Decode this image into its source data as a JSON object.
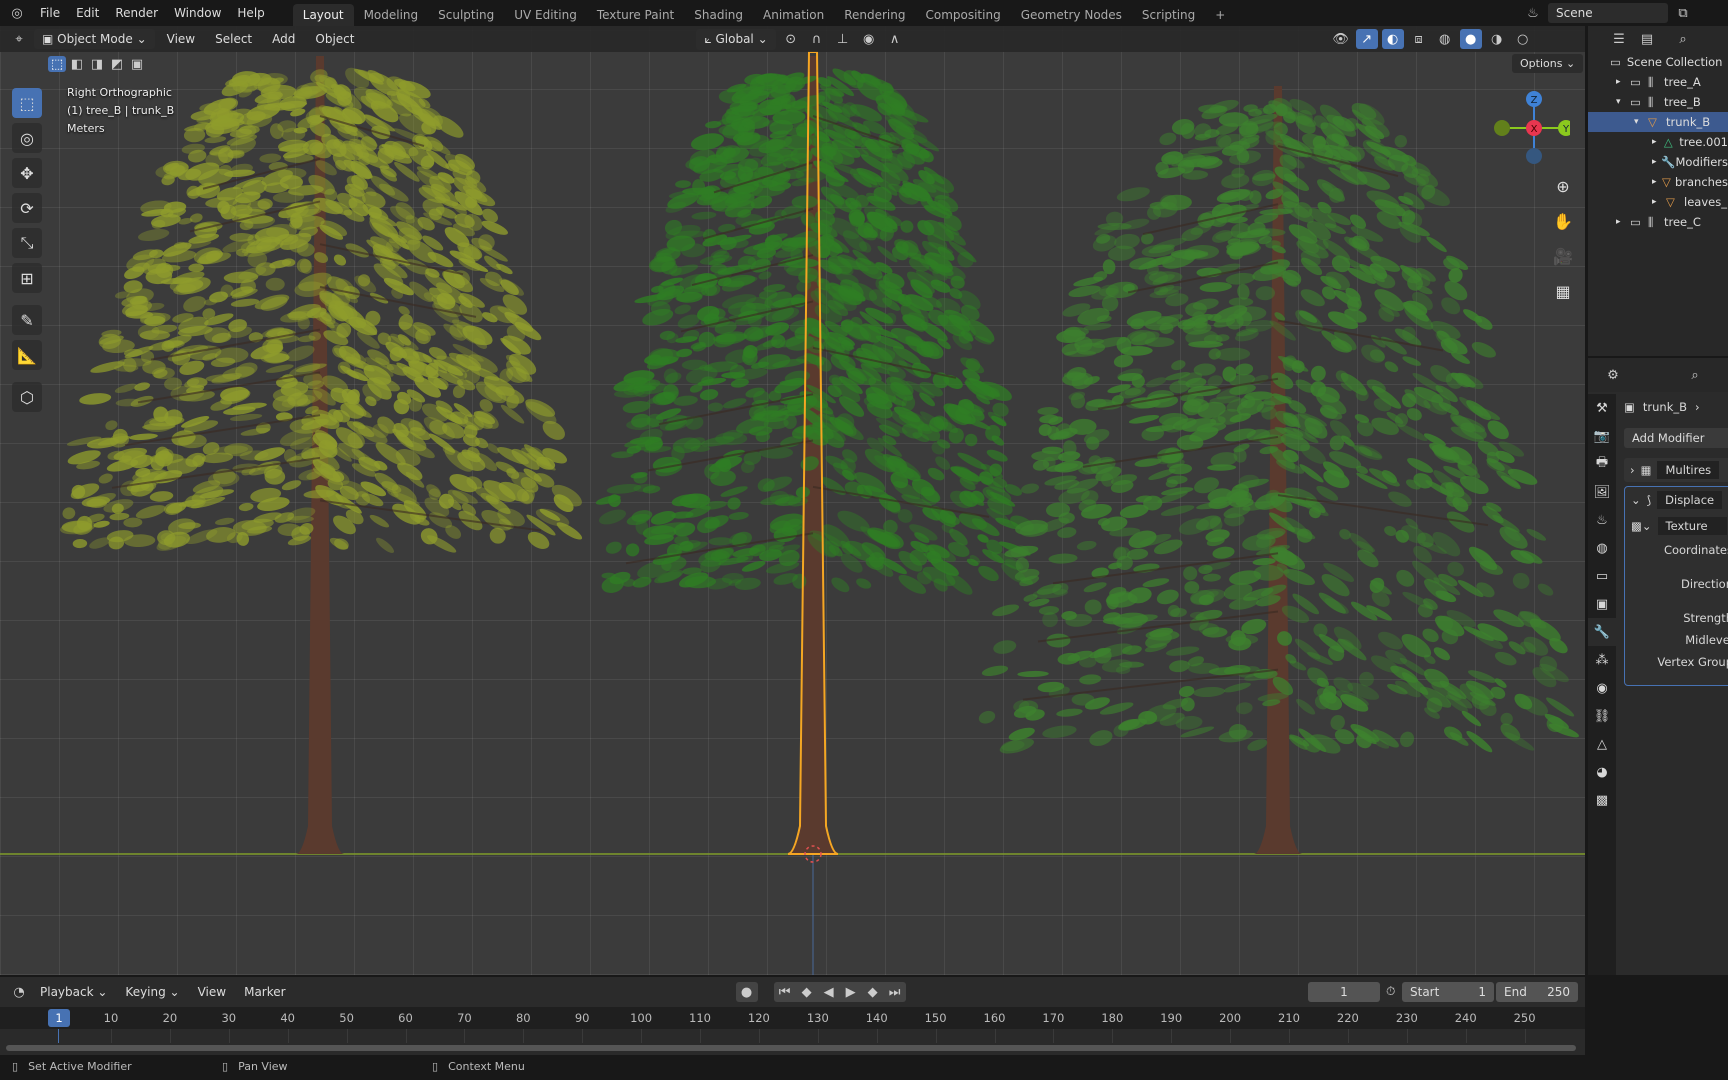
{
  "topbar": {
    "logo": "blender-logo",
    "menus": [
      "File",
      "Edit",
      "Render",
      "Window",
      "Help"
    ],
    "workspaces": [
      "Layout",
      "Modeling",
      "Sculpting",
      "UV Editing",
      "Texture Paint",
      "Shading",
      "Animation",
      "Rendering",
      "Compositing",
      "Geometry Nodes",
      "Scripting"
    ],
    "active_workspace": "Layout",
    "add_tab": "+",
    "scene": "Scene"
  },
  "viewport_header": {
    "mode": "Object Mode",
    "menus": [
      "View",
      "Select",
      "Add",
      "Object"
    ],
    "orientation": "Global",
    "options": "Options"
  },
  "overlay": {
    "view": "Right Orthographic",
    "object": "(1) tree_B | trunk_B",
    "units": "Meters"
  },
  "gizmo": {
    "z": "Z",
    "x": "X",
    "y": "Y",
    "colors": {
      "x": "#e8364f",
      "y": "#8bc91e",
      "z": "#3f82d6"
    }
  },
  "toolbar": [
    "select-box",
    "cursor",
    "move",
    "rotate",
    "scale",
    "transform",
    "annotate",
    "measure",
    "add-cube"
  ],
  "nav_icons": [
    "zoom",
    "pan-hand",
    "camera",
    "ortho-grid"
  ],
  "outliner": {
    "root": "Scene Collection",
    "items": [
      {
        "label": "tree_A",
        "depth": 0,
        "exp": "▸",
        "icon": "collection"
      },
      {
        "label": "tree_B",
        "depth": 0,
        "exp": "▾",
        "icon": "collection"
      },
      {
        "label": "trunk_B",
        "depth": 1,
        "exp": "▾",
        "icon": "mesh-object",
        "selected": true
      },
      {
        "label": "tree.001",
        "depth": 2,
        "exp": "▸",
        "icon": "mesh-data"
      },
      {
        "label": "Modifiers",
        "depth": 2,
        "exp": "▸",
        "icon": "wrench"
      },
      {
        "label": "branches",
        "depth": 2,
        "exp": "▸",
        "icon": "mesh-object"
      },
      {
        "label": "leaves_",
        "depth": 2,
        "exp": "▸",
        "icon": "mesh-object"
      },
      {
        "label": "tree_C",
        "depth": 0,
        "exp": "▸",
        "icon": "collection"
      }
    ]
  },
  "properties": {
    "object": "trunk_B",
    "add_modifier": "Add Modifier",
    "modifiers": [
      {
        "name": "Multires",
        "expanded": false
      },
      {
        "name": "Displace",
        "expanded": true
      }
    ],
    "texture_label": "Texture",
    "fields": [
      "Coordinates",
      "Direction",
      "Strength",
      "Midlevel",
      "Vertex Group"
    ],
    "tabs": [
      "tool",
      "render",
      "output",
      "view-layer",
      "scene",
      "world",
      "collection",
      "object",
      "modifiers",
      "particles",
      "physics",
      "constraints",
      "data",
      "material",
      "texture"
    ],
    "active_tab": "modifiers"
  },
  "timeline": {
    "menus": [
      "Playback",
      "Keying",
      "View",
      "Marker"
    ],
    "current_frame": "1",
    "start_label": "Start",
    "start": "1",
    "end_label": "End",
    "end": "250",
    "ticks": [
      "10",
      "20",
      "30",
      "40",
      "50",
      "60",
      "70",
      "80",
      "90",
      "100",
      "110",
      "120",
      "130",
      "140",
      "150",
      "160",
      "170",
      "180",
      "190",
      "200",
      "210",
      "220",
      "230",
      "240",
      "250"
    ]
  },
  "status": [
    "Set Active Modifier",
    "Pan View",
    "Context Menu"
  ],
  "colors": {
    "accent": "#4772b3",
    "selection": "#f5a623",
    "foliage_a": "#8f9c2c",
    "foliage_b": "#2f7d24",
    "foliage_c": "#3d812e",
    "trunk": "#5a3a2e"
  }
}
